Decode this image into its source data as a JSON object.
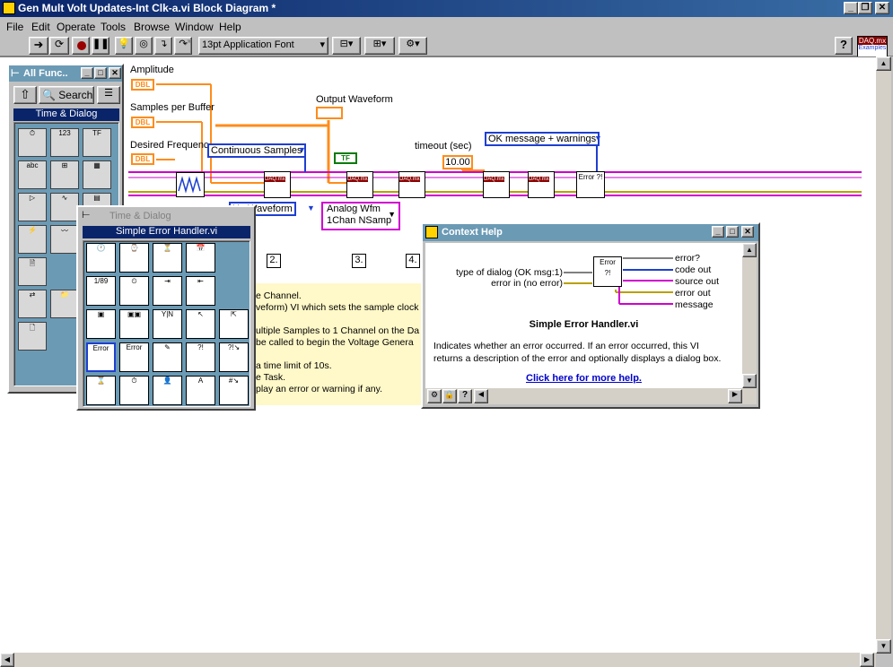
{
  "window": {
    "title": "Gen Mult Volt Updates-Int Clk-a.vi Block Diagram *",
    "controls": {
      "minimize": "_",
      "restore": "❐",
      "close": "✕"
    }
  },
  "menu": [
    "File",
    "Edit",
    "Operate",
    "Tools",
    "Browse",
    "Window",
    "Help"
  ],
  "toolbar": {
    "font_selector": "13pt Application Font",
    "help_icon": "?",
    "daq_badge": "DAQ.mx",
    "examples_label": "Examples"
  },
  "diagram": {
    "labels": {
      "amplitude": "Amplitude",
      "samples_per_buffer": "Samples per Buffer",
      "desired_frequency": "Desired Frequenc",
      "output_waveform": "Output Waveform",
      "timeout": "timeout (sec)",
      "timeout_value": "10.00",
      "dbl": "DBL",
      "bool_tf": "TF",
      "daq": "DAQ.mx",
      "error_icon": "Error ?!"
    },
    "enums": {
      "continuous_samples": "Continuous Samples",
      "ok_message": "OK message + warnings",
      "analog_waveform": "Ue Waveform",
      "analog_wfm_1": "Analog Wfm",
      "analog_wfm_2": "1Chan NSamp"
    },
    "steps": [
      "2.",
      "3.",
      "4."
    ],
    "comment_lines": [
      "e Channel.",
      "veform) VI which sets the sample clock",
      "",
      "ultiple Samples to 1 Channel on the Da",
      "be called to begin the Voltage  Genera",
      "",
      "a time limit of 10s.",
      "e Task.",
      "play an error or warning if any."
    ]
  },
  "functions_palette": {
    "title": "All Func..",
    "search": "Search",
    "category": "Time & Dialog"
  },
  "subpalette": {
    "title": "Time & Dialog",
    "selected": "Simple Error Handler.vi"
  },
  "context_help": {
    "title": "Context Help",
    "inputs": [
      "type of dialog (OK msg:1)",
      "error in (no error)"
    ],
    "outputs": [
      "error?",
      "code out",
      "source out",
      "error out",
      "message"
    ],
    "vi_name": "Simple Error Handler.vi",
    "description": "Indicates whether an error occurred. If an error occurred, this VI returns a description of the error and optionally displays a dialog box.",
    "link": "Click here for more help."
  },
  "colors": {
    "error_wire": "#b8a000",
    "task_wire": "#d000d0",
    "numeric": "#ff8c1a",
    "enum": "#1f3fd0"
  }
}
